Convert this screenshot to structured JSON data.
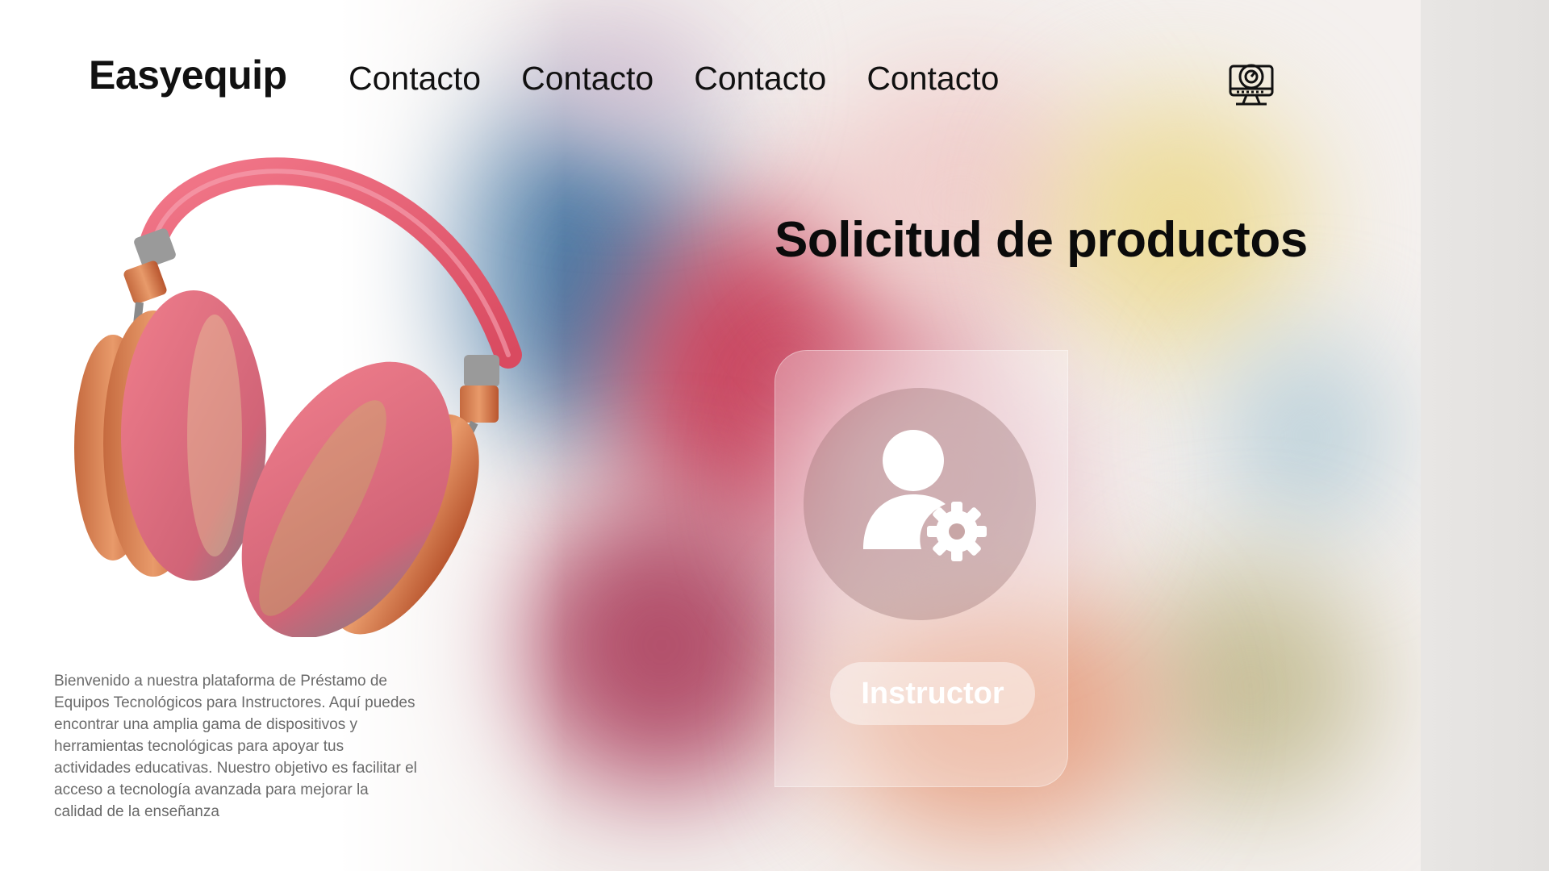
{
  "brand": {
    "name": "Easyequip"
  },
  "nav": {
    "items": [
      "Contacto",
      "Contacto",
      "Contacto",
      "Contacto"
    ]
  },
  "header_icon": "monitor-gauge-icon",
  "hero": {
    "image": "headphones-illustration",
    "description": "Bienvenido a nuestra plataforma de Préstamo de Equipos Tecnológicos para Instructores. Aquí puedes encontrar una amplia gama de dispositivos y herramientas tecnológicas para apoyar tus actividades educativas. Nuestro objetivo es facilitar el acceso a tecnología avanzada para mejorar la calidad de la enseñanza"
  },
  "main": {
    "title": "Solicitud de productos",
    "role_card": {
      "icon": "user-gear-icon",
      "label": "Instructor"
    }
  },
  "colors": {
    "text": "#111111",
    "description": "#6a6a6a",
    "accent_red": "#e0485e"
  }
}
